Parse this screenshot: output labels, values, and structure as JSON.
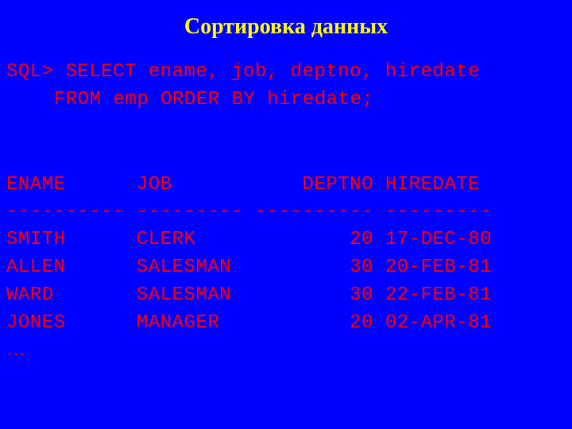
{
  "title": "Сортировка данных",
  "sql": {
    "prompt": "SQL>",
    "line1": "SELECT ename, job, deptno, hiredate",
    "line2_from": "FROM emp",
    "line2_order": "ORDER BY",
    "line2_rest": "hiredate;"
  },
  "result": {
    "header": "ENAME      JOB           DEPTNO HIREDATE",
    "divider": "---------- --------- ---------- ---------",
    "rows": [
      "SMITH      CLERK             20 17-DEC-80",
      "ALLEN      SALESMAN          30 20-FEB-81",
      "WARD       SALESMAN          30 22-FEB-81",
      "JONES      MANAGER           20 02-APR-81"
    ],
    "ellipsis": "…"
  },
  "chart_data": {
    "type": "table",
    "title": "Сортировка данных",
    "query": "SELECT ename, job, deptno, hiredate FROM emp ORDER BY hiredate;",
    "columns": [
      "ENAME",
      "JOB",
      "DEPTNO",
      "HIREDATE"
    ],
    "rows": [
      {
        "ENAME": "SMITH",
        "JOB": "CLERK",
        "DEPTNO": 20,
        "HIREDATE": "17-DEC-80"
      },
      {
        "ENAME": "ALLEN",
        "JOB": "SALESMAN",
        "DEPTNO": 30,
        "HIREDATE": "20-FEB-81"
      },
      {
        "ENAME": "WARD",
        "JOB": "SALESMAN",
        "DEPTNO": 30,
        "HIREDATE": "22-FEB-81"
      },
      {
        "ENAME": "JONES",
        "JOB": "MANAGER",
        "DEPTNO": 20,
        "HIREDATE": "02-APR-81"
      }
    ],
    "truncated": true
  }
}
